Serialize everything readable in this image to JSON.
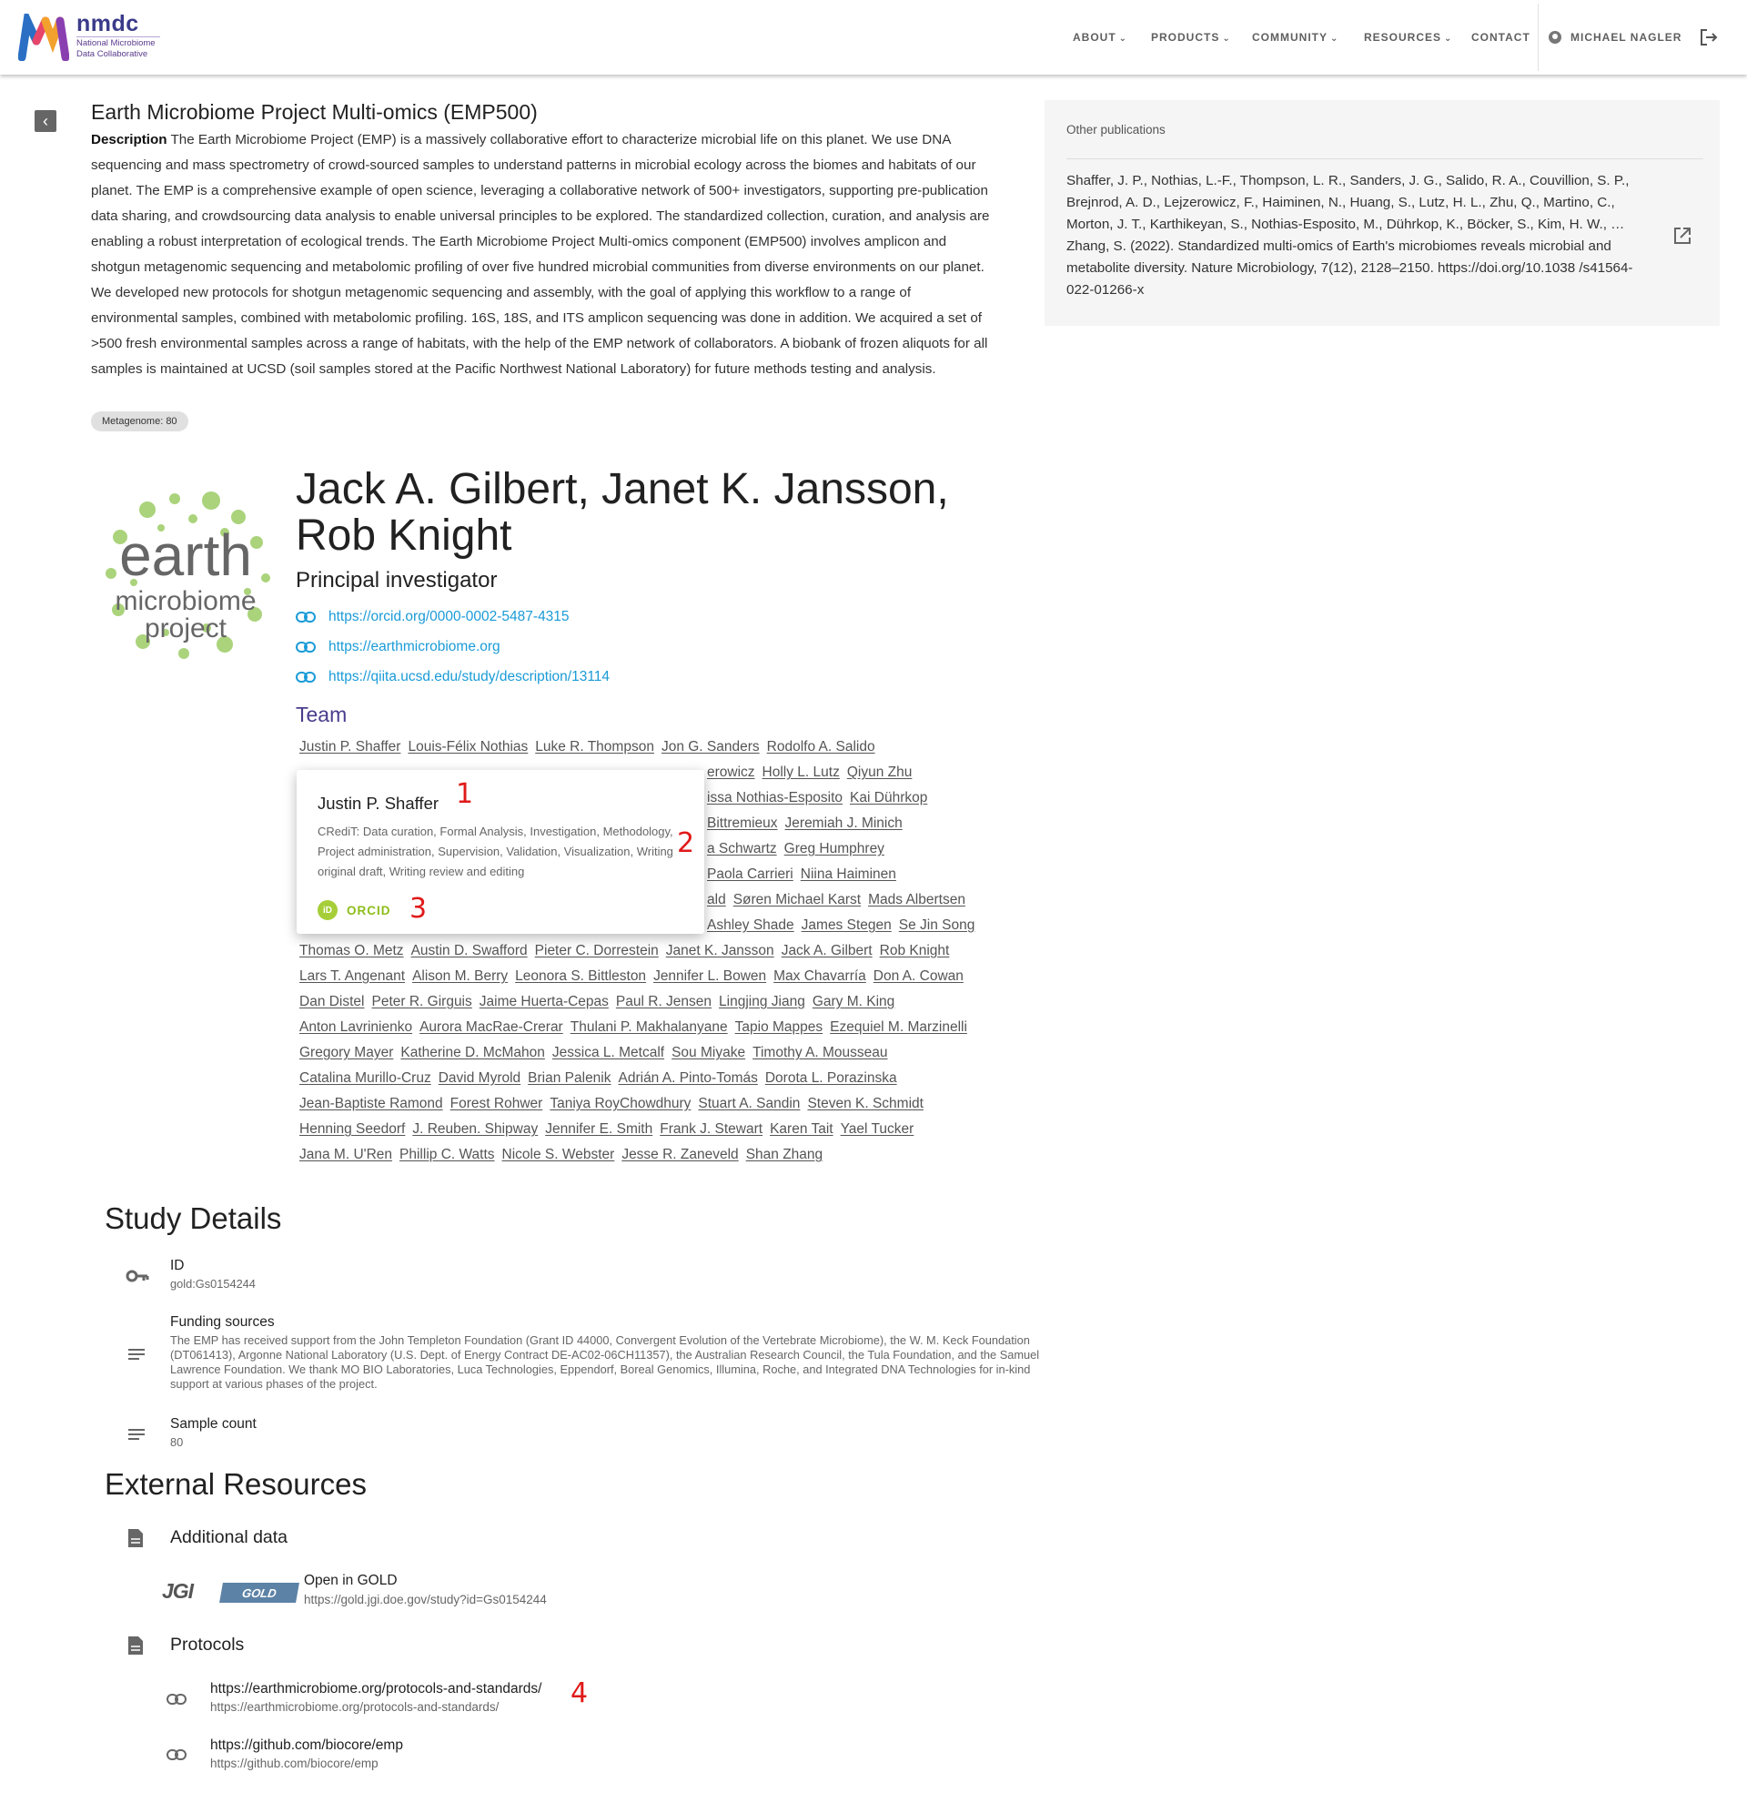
{
  "header": {
    "logo_text": "nmdc",
    "logo_subtitle_line1": "National Microbiome",
    "logo_subtitle_line2": "Data Collaborative",
    "nav": [
      "ABOUT",
      "PRODUCTS",
      "COMMUNITY",
      "RESOURCES",
      "CONTACT"
    ],
    "user_name": "MICHAEL NAGLER"
  },
  "study": {
    "title": "Earth Microbiome Project Multi-omics (EMP500)",
    "description_label": "Description",
    "description": "The Earth Microbiome Project (EMP) is a massively collaborative effort to characterize microbial life on this planet. We use DNA sequencing and mass spectrometry of crowd-sourced samples to understand patterns in microbial ecology across the biomes and habitats of our planet. The EMP is a comprehensive example of open science, leveraging a collaborative network of 500+ investigators, supporting pre-publication data sharing, and crowdsourcing data analysis to enable universal principles to be explored. The standardized collection, curation, and analysis are enabling a robust interpretation of ecological trends. The Earth Microbiome Project Multi-omics component (EMP500) involves amplicon and shotgun metagenomic sequencing and metabolomic profiling of over five hundred microbial communities from diverse environments on our planet. We developed new protocols for shotgun metagenomic sequencing and assembly, with the goal of applying this workflow to a range of environmental samples, combined with metabolomic profiling. 16S, 18S, and ITS amplicon sequencing was done in addition. We acquired a set of >500 fresh environmental samples across a range of habitats, with the help of the EMP network of collaborators. A biobank of frozen aliquots for all samples is maintained at UCSD (soil samples stored at the Pacific Northwest National Laboratory) for future methods testing and analysis.",
    "chip": "Metagenome: 80"
  },
  "publications": {
    "heading": "Other publications",
    "entry": "Shaffer, J. P., Nothias, L.-F., Thompson, L. R., Sanders, J. G., Salido, R. A., Couvillion, S. P., Brejnrod, A. D., Lejzerowicz, F., Haiminen, N., Huang, S., Lutz, H. L., Zhu, Q., Martino, C., Morton, J. T., Karthikeyan, S., Nothias-Esposito, M., Dührkop, K., Böcker, S., Kim, H. W., … Zhang, S. (2022). Standardized multi-omics of Earth's microbiomes reveals microbial and metabolite diversity. Nature Microbiology, 7(12), 2128–2150. https://doi.org/10.1038 /s41564-022-01266-x"
  },
  "pi": {
    "logo_text_1": "earth",
    "logo_text_2": "microbiome",
    "logo_text_3": "project",
    "names": "Jack A. Gilbert, Janet K. Jansson, Rob Knight",
    "role": "Principal investigator",
    "links": [
      "https://orcid.org/0000-0002-5487-4315",
      "https://earthmicrobiome.org",
      "https://qiita.ucsd.edu/study/description/13114"
    ]
  },
  "team": {
    "heading": "Team",
    "rows": [
      [
        "Justin P. Shaffer",
        "Louis-Félix Nothias",
        "Luke R. Thompson",
        "Jon G. Sanders",
        "Rodolfo A. Salido"
      ],
      [
        "erowicz",
        "Holly L. Lutz",
        "Qiyun Zhu"
      ],
      [
        "issa Nothias-Esposito",
        "Kai Dührkop"
      ],
      [
        "Bittremieux",
        "Jeremiah J. Minich"
      ],
      [
        "a Schwartz",
        "Greg Humphrey"
      ],
      [
        "Paola Carrieri",
        "Niina Haiminen"
      ],
      [
        "ald",
        "Søren Michael Karst",
        "Mads Albertsen"
      ],
      [
        "Ashley Shade",
        "James Stegen",
        "Se Jin Song"
      ],
      [
        "Thomas O. Metz",
        "Austin D. Swafford",
        "Pieter C. Dorrestein",
        "Janet K. Jansson",
        "Jack A. Gilbert",
        "Rob Knight"
      ],
      [
        "Lars T. Angenant",
        "Alison M. Berry",
        "Leonora S. Bittleston",
        "Jennifer L. Bowen",
        "Max Chavarría",
        "Don A. Cowan"
      ],
      [
        "Dan Distel",
        "Peter R. Girguis",
        "Jaime Huerta-Cepas",
        "Paul R. Jensen",
        "Lingjing Jiang",
        "Gary M. King"
      ],
      [
        "Anton Lavrinienko",
        "Aurora MacRae-Crerar",
        "Thulani P. Makhalanyane",
        "Tapio Mappes",
        "Ezequiel M. Marzinelli"
      ],
      [
        "Gregory Mayer",
        "Katherine D. McMahon",
        "Jessica L. Metcalf",
        "Sou Miyake",
        "Timothy A. Mousseau"
      ],
      [
        "Catalina Murillo-Cruz",
        "David Myrold",
        "Brian Palenik",
        "Adrián A. Pinto-Tomás",
        "Dorota L. Porazinska"
      ],
      [
        "Jean-Baptiste Ramond",
        "Forest Rohwer",
        "Taniya RoyChowdhury",
        "Stuart A. Sandin",
        "Steven K. Schmidt"
      ],
      [
        "Henning Seedorf",
        "J. Reuben. Shipway",
        "Jennifer E. Smith",
        "Frank J. Stewart",
        "Karen Tait",
        "Yael Tucker"
      ],
      [
        "Jana M. U'Ren",
        "Phillip C. Watts",
        "Nicole S. Webster",
        "Jesse R. Zaneveld",
        "Shan Zhang"
      ]
    ]
  },
  "popup": {
    "name": "Justin P. Shaffer",
    "credit": "CRediT: Data curation, Formal Analysis, Investigation, Methodology, Project administration, Supervision, Validation, Visualization, Writing original draft, Writing review and editing",
    "orcid_badge": "iD",
    "orcid_label": "ORCID"
  },
  "markers": [
    "1",
    "2",
    "3",
    "4"
  ],
  "details": {
    "heading": "Study Details",
    "id_label": "ID",
    "id_value": "gold:Gs0154244",
    "funding_label": "Funding sources",
    "funding_value": "The EMP has received support from the John Templeton Foundation (Grant ID 44000, Convergent Evolution of the Vertebrate Microbiome), the W. M. Keck Foundation (DT061413), Argonne National Laboratory (U.S. Dept. of Energy Contract DE-AC02-06CH11357), the Australian Research Council, the Tula Foundation, and the Samuel Lawrence Foundation. We thank MO BIO Laboratories, Luca Technologies, Eppendorf, Boreal Genomics, Illumina, Roche, and Integrated DNA Technologies for in-kind support at various phases of the project.",
    "sample_label": "Sample count",
    "sample_value": "80"
  },
  "external": {
    "heading": "External Resources",
    "additional_label": "Additional data",
    "jgi_text": "JGI",
    "gold_badge": "GOLD",
    "gold_title": "Open in GOLD",
    "gold_url": "https://gold.jgi.doe.gov/study?id=Gs0154244",
    "protocols_label": "Protocols",
    "protocols": [
      {
        "title": "https://earthmicrobiome.org/protocols-and-standards/",
        "url": "https://earthmicrobiome.org/protocols-and-standards/"
      },
      {
        "title": "https://github.com/biocore/emp",
        "url": "https://github.com/biocore/emp"
      }
    ]
  },
  "colors": {
    "link": "#1a9bd7",
    "team_heading": "#4a3c8c",
    "orcid_green": "#a6ce39",
    "marker_red": "#e01a1a",
    "gold_badge": "#5c82a6"
  }
}
